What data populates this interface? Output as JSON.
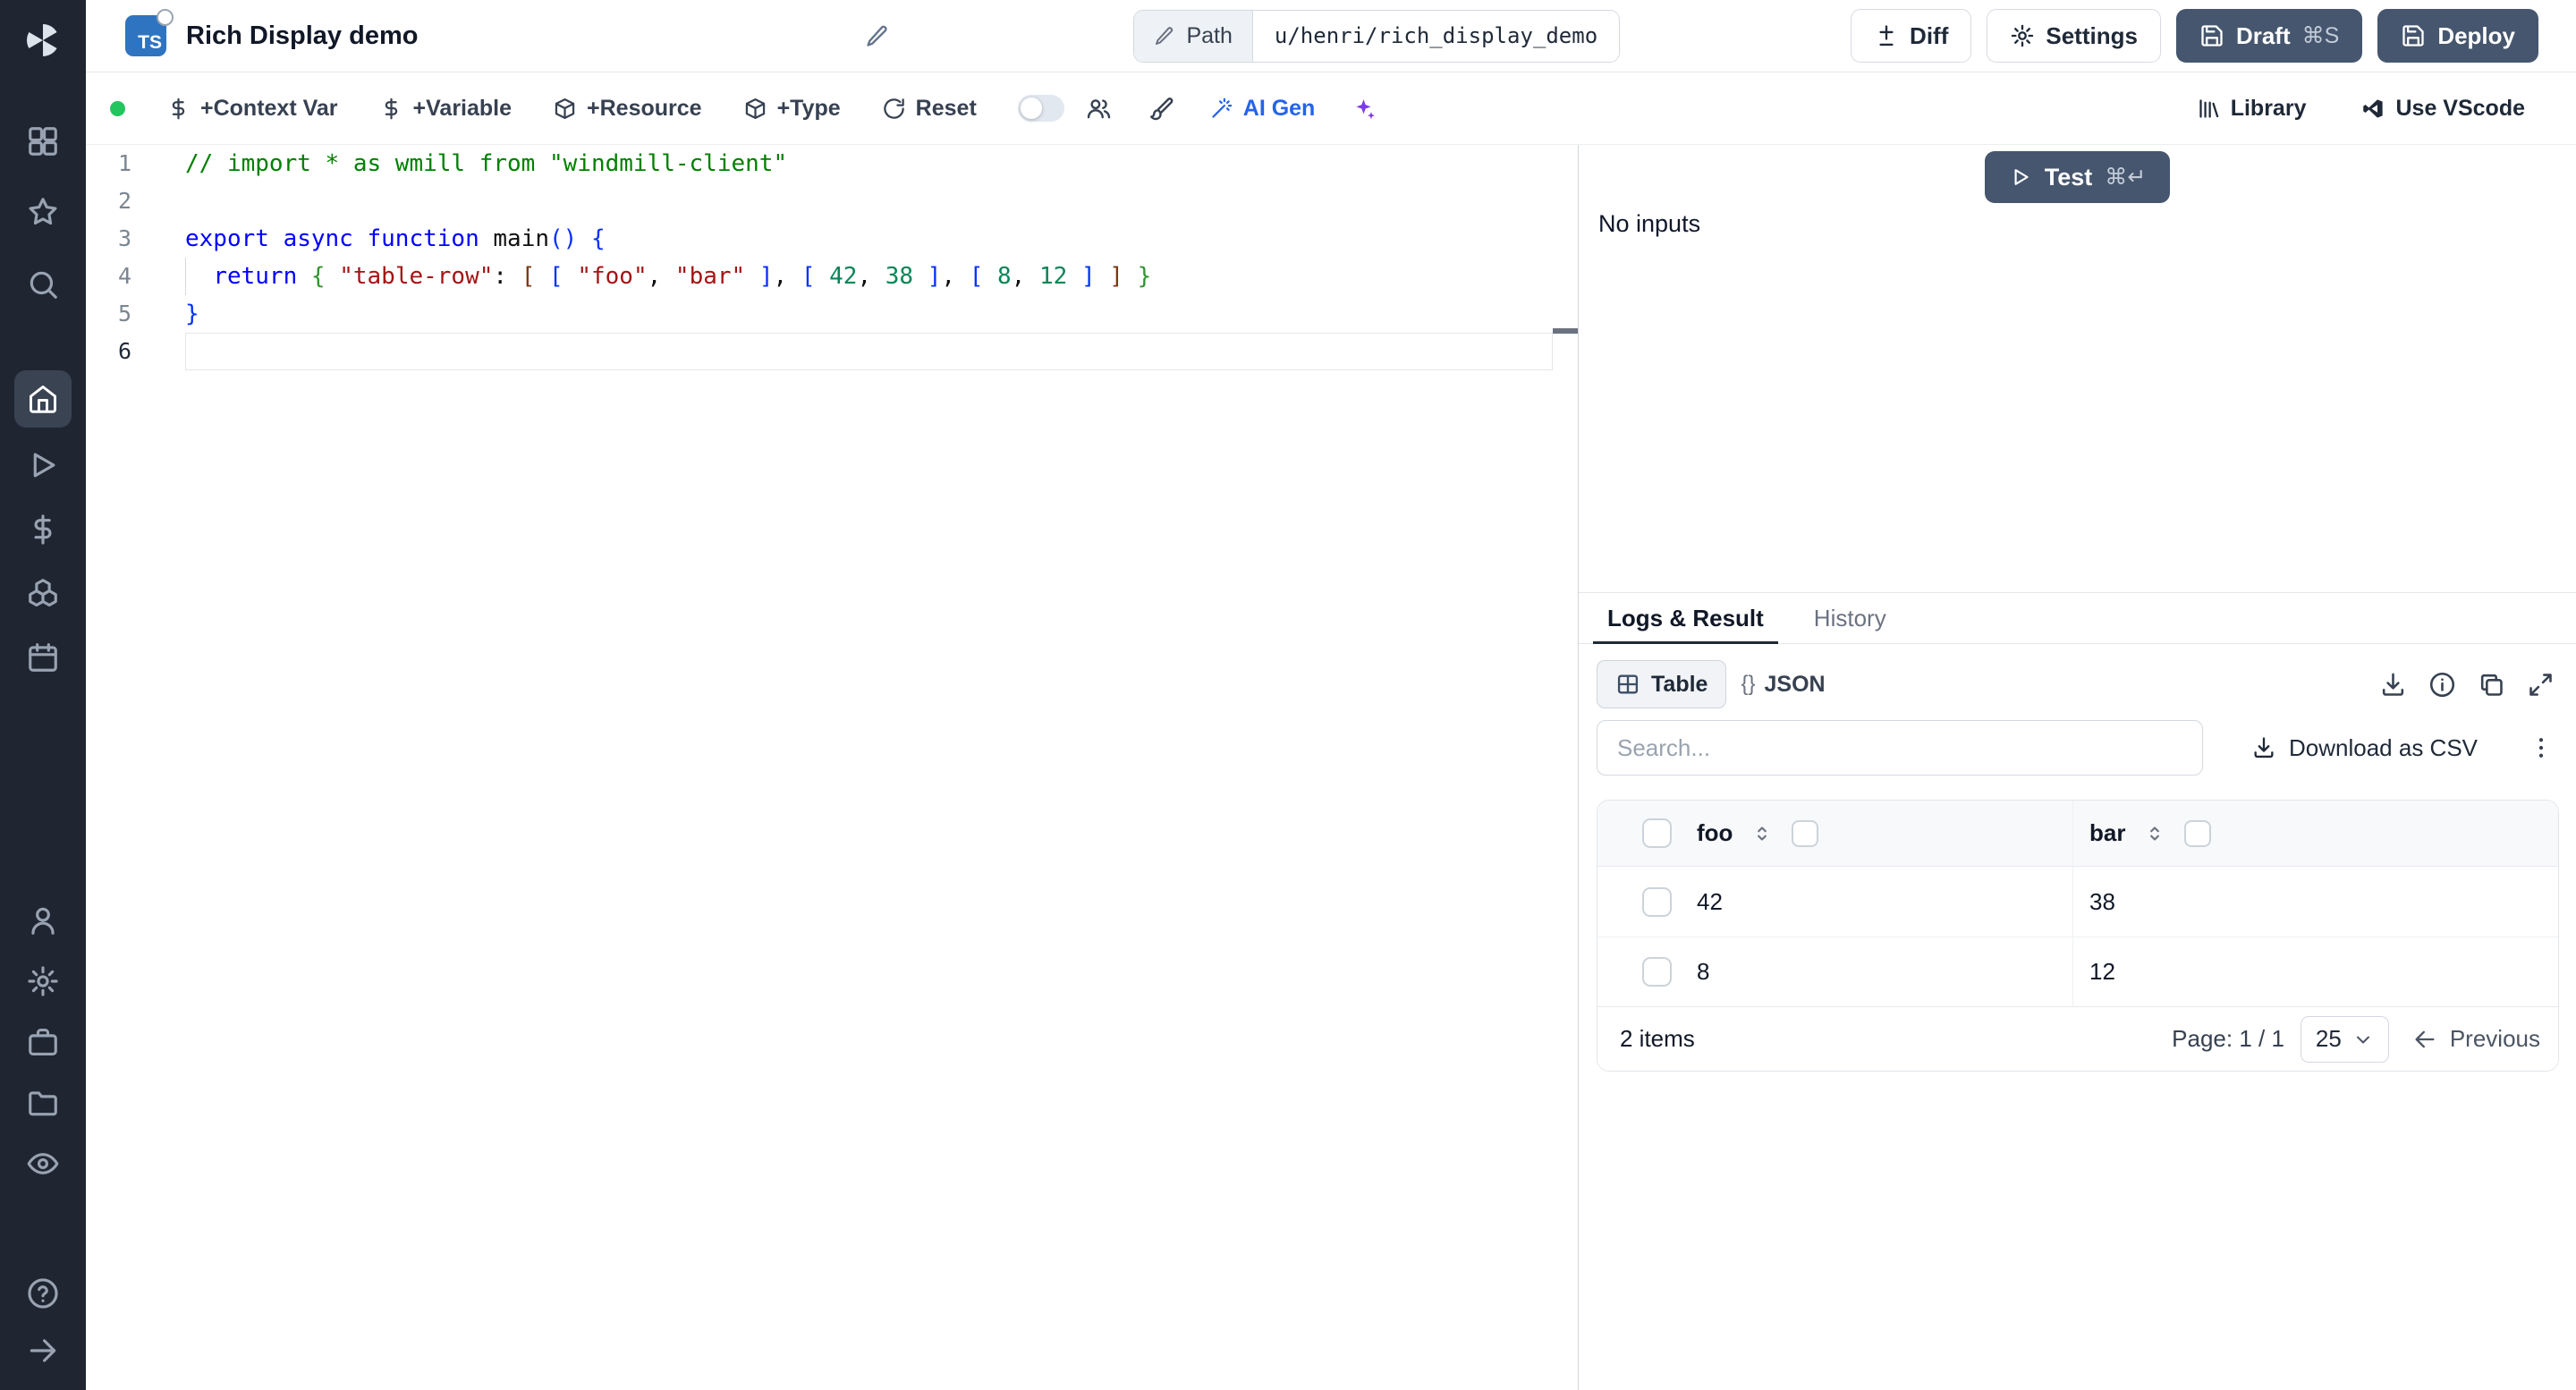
{
  "topbar": {
    "lang_badge": "TS",
    "title": "Rich Display demo",
    "path_label": "Path",
    "path_value": "u/henri/rich_display_demo",
    "diff_label": "Diff",
    "settings_label": "Settings",
    "draft_label": "Draft",
    "draft_shortcut": "⌘S",
    "deploy_label": "Deploy"
  },
  "toolbar": {
    "context_var_label": "+Context Var",
    "variable_label": "+Variable",
    "resource_label": "+Resource",
    "type_label": "+Type",
    "reset_label": "Reset",
    "ai_gen_label": "AI Gen",
    "library_label": "Library",
    "vscode_label": "Use VScode"
  },
  "editor": {
    "lines": [
      {
        "n": 1,
        "segments": [
          {
            "t": "// import * as wmill from \"windmill-client\"",
            "c": "comment"
          }
        ]
      },
      {
        "n": 2,
        "segments": []
      },
      {
        "n": 3,
        "segments": [
          {
            "t": "export async function",
            "c": "kw"
          },
          {
            "t": " main",
            "c": "plain"
          },
          {
            "t": "()",
            "c": "b1"
          },
          {
            "t": " ",
            "c": "plain"
          },
          {
            "t": "{",
            "c": "b1"
          }
        ]
      },
      {
        "n": 4,
        "segments": [
          {
            "t": "  ",
            "c": "plain"
          },
          {
            "t": "return",
            "c": "kw"
          },
          {
            "t": " ",
            "c": "plain"
          },
          {
            "t": "{",
            "c": "b2"
          },
          {
            "t": " ",
            "c": "plain"
          },
          {
            "t": "\"table-row\"",
            "c": "str"
          },
          {
            "t": ": ",
            "c": "plain"
          },
          {
            "t": "[",
            "c": "b3"
          },
          {
            "t": " ",
            "c": "plain"
          },
          {
            "t": "[",
            "c": "b1"
          },
          {
            "t": " ",
            "c": "plain"
          },
          {
            "t": "\"foo\"",
            "c": "str"
          },
          {
            "t": ", ",
            "c": "plain"
          },
          {
            "t": "\"bar\"",
            "c": "str"
          },
          {
            "t": " ",
            "c": "plain"
          },
          {
            "t": "]",
            "c": "b1"
          },
          {
            "t": ", ",
            "c": "plain"
          },
          {
            "t": "[",
            "c": "b1"
          },
          {
            "t": " ",
            "c": "plain"
          },
          {
            "t": "42",
            "c": "num"
          },
          {
            "t": ", ",
            "c": "plain"
          },
          {
            "t": "38",
            "c": "num"
          },
          {
            "t": " ",
            "c": "plain"
          },
          {
            "t": "]",
            "c": "b1"
          },
          {
            "t": ", ",
            "c": "plain"
          },
          {
            "t": "[",
            "c": "b1"
          },
          {
            "t": " ",
            "c": "plain"
          },
          {
            "t": "8",
            "c": "num"
          },
          {
            "t": ", ",
            "c": "plain"
          },
          {
            "t": "12",
            "c": "num"
          },
          {
            "t": " ",
            "c": "plain"
          },
          {
            "t": "]",
            "c": "b1"
          },
          {
            "t": " ",
            "c": "plain"
          },
          {
            "t": "]",
            "c": "b3"
          },
          {
            "t": " ",
            "c": "plain"
          },
          {
            "t": "}",
            "c": "b2"
          }
        ]
      },
      {
        "n": 5,
        "segments": [
          {
            "t": "}",
            "c": "b1"
          }
        ]
      },
      {
        "n": 6,
        "current": true,
        "segments": []
      }
    ]
  },
  "preview": {
    "test_label": "Test",
    "test_shortcut": "⌘↵",
    "no_inputs": "No inputs",
    "tabs": [
      {
        "label": "Logs & Result",
        "active": true
      },
      {
        "label": "History",
        "active": false
      }
    ],
    "view_table_label": "Table",
    "view_json_braces": "{}",
    "view_json_label": "JSON",
    "search_placeholder": "Search...",
    "download_csv_label": "Download as CSV"
  },
  "result_table": {
    "columns": [
      "foo",
      "bar"
    ],
    "rows": [
      [
        "42",
        "38"
      ],
      [
        "8",
        "12"
      ]
    ],
    "items_label": "2 items",
    "page_label": "Page: 1 / 1",
    "page_size": "25",
    "previous_label": "Previous"
  }
}
